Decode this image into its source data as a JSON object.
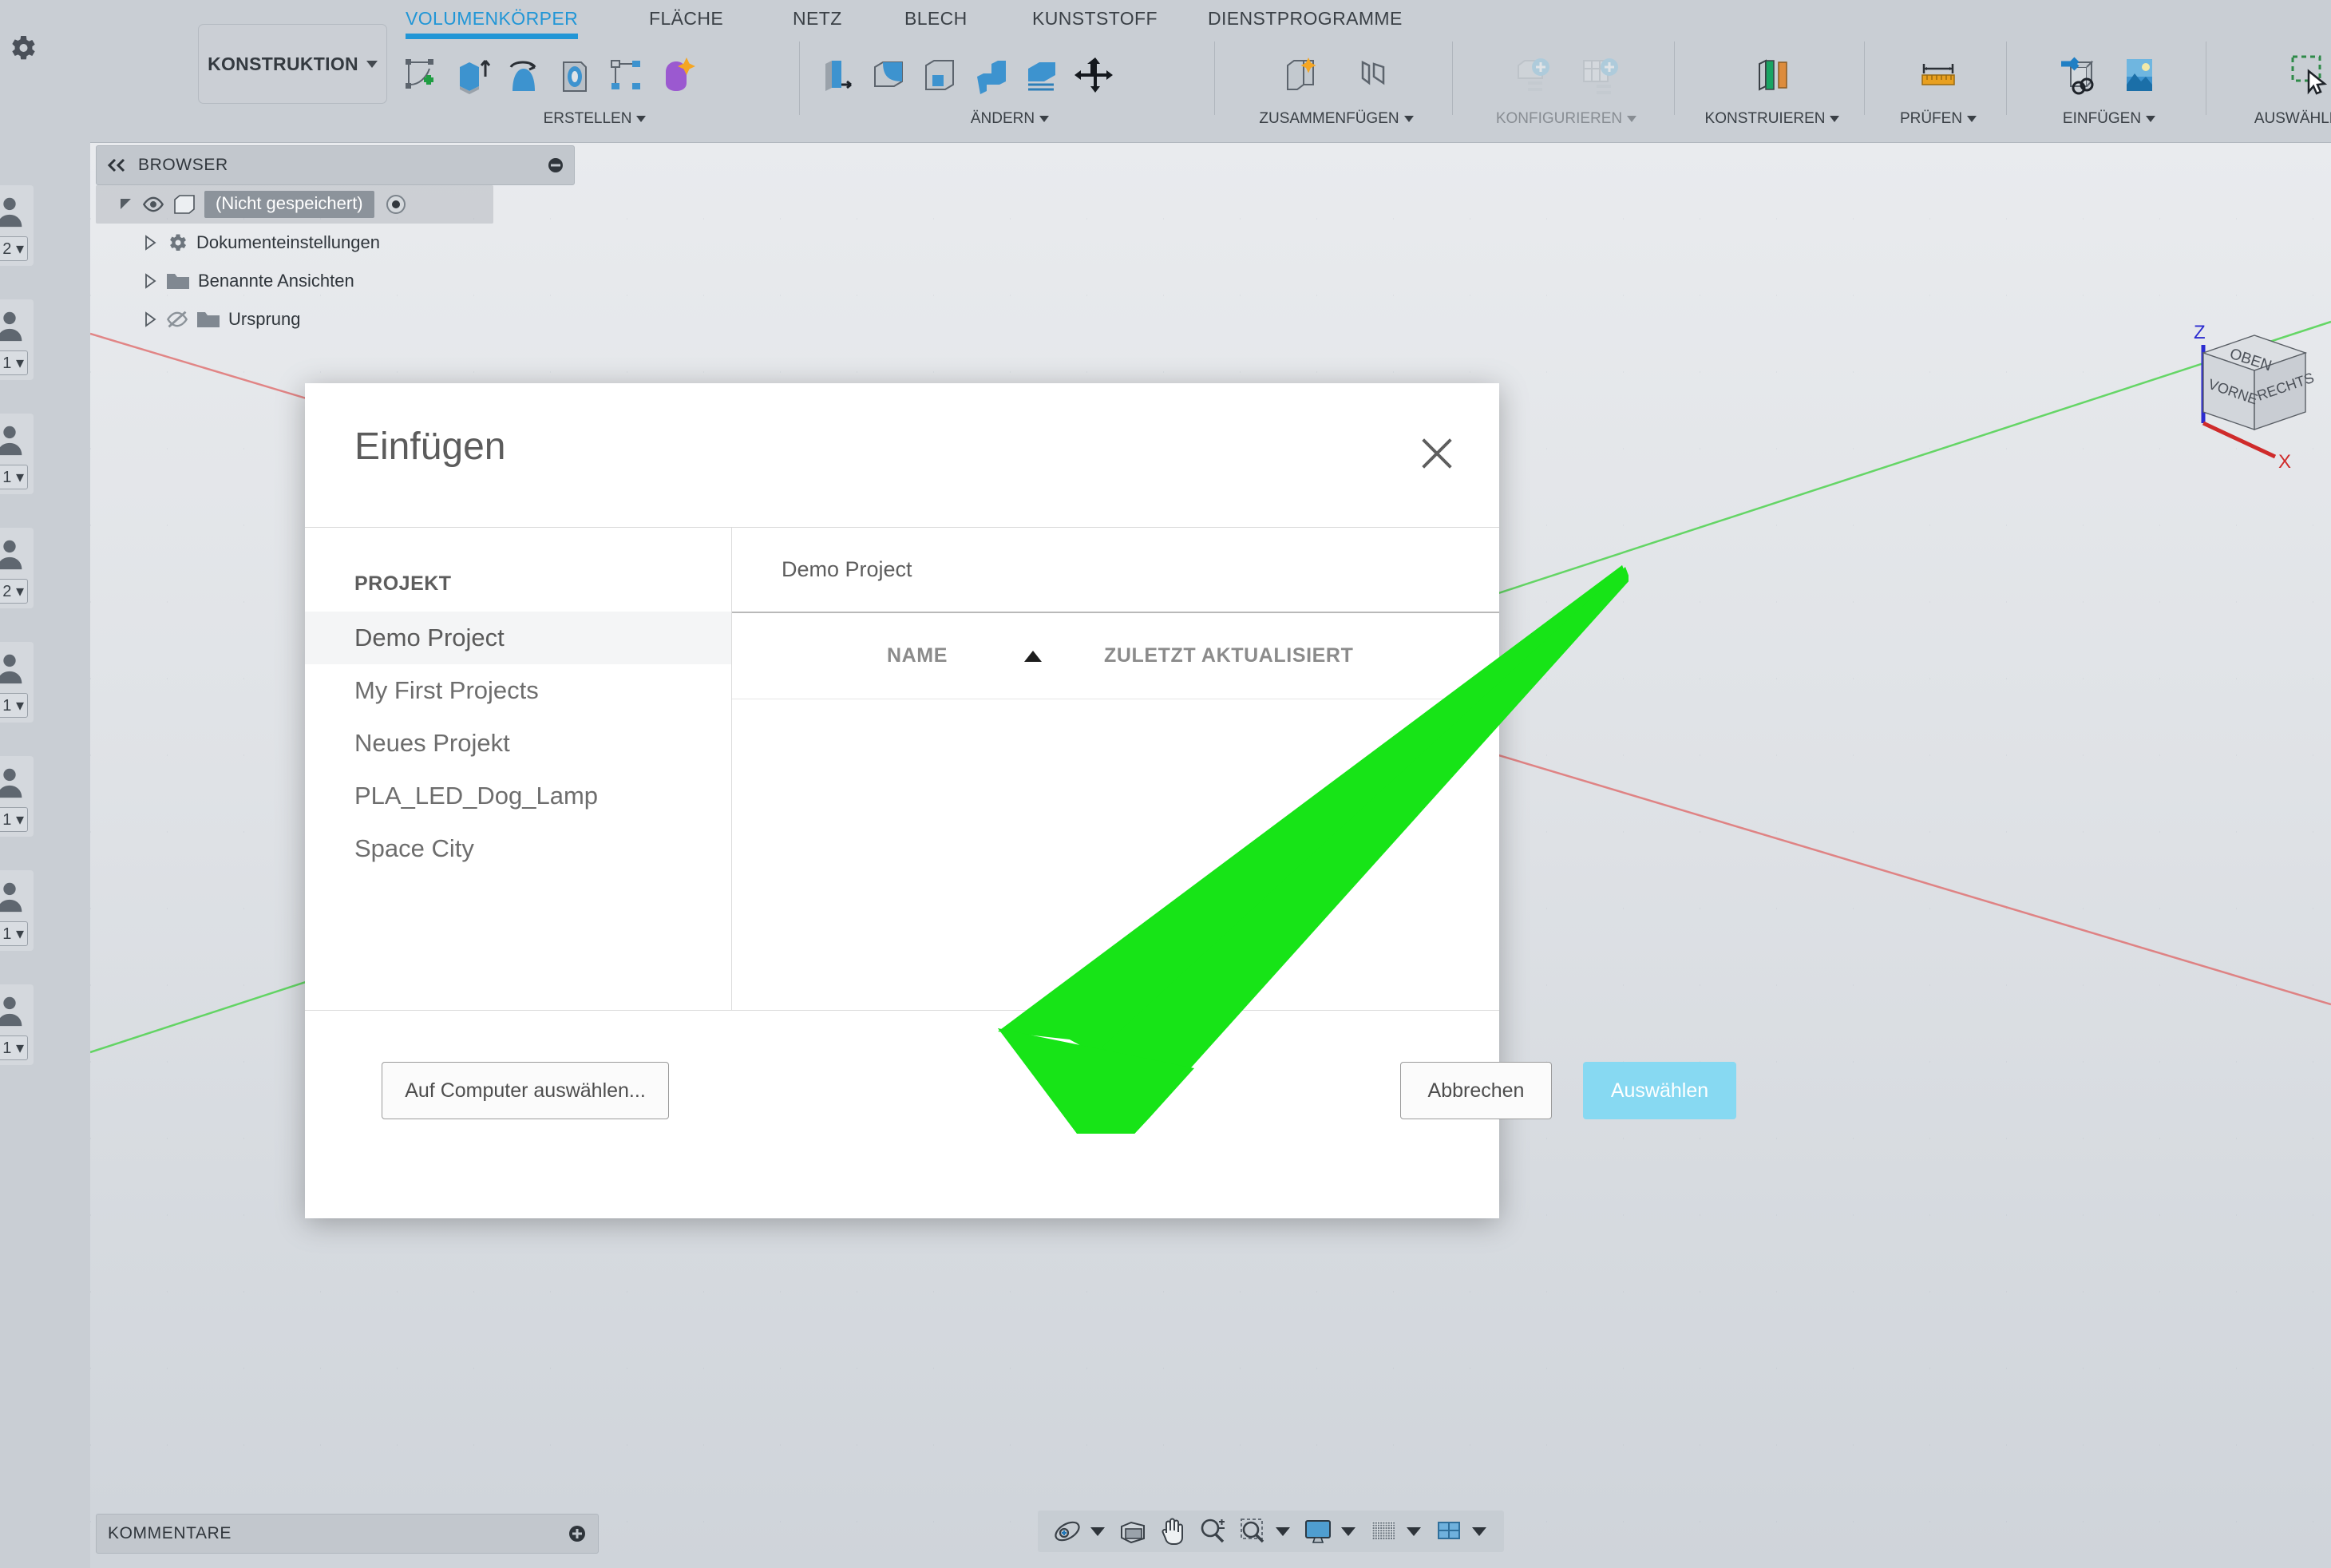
{
  "app": {
    "workspace_button": "KONSTRUKTION",
    "settings_icon": "gear-icon"
  },
  "ribbon": {
    "tabs": [
      {
        "label": "VOLUMENKÖRPER",
        "active": true
      },
      {
        "label": "FLÄCHE",
        "active": false
      },
      {
        "label": "NETZ",
        "active": false
      },
      {
        "label": "BLECH",
        "active": false
      },
      {
        "label": "KUNSTSTOFF",
        "active": false
      },
      {
        "label": "DIENSTPROGRAMME",
        "active": false
      }
    ],
    "panels": [
      {
        "label": "ERSTELLEN",
        "icons": [
          "sketch-create-icon",
          "extrude-icon",
          "revolve-icon",
          "sweep-icon",
          "pattern-icon",
          "form-icon"
        ]
      },
      {
        "label": "ÄNDERN",
        "icons": [
          "press-pull-icon",
          "fillet-icon",
          "shell-icon",
          "combine-icon",
          "offset-face-icon",
          "move-copy-icon"
        ]
      },
      {
        "label": "ZUSAMMENFÜGEN",
        "icons": [
          "new-component-icon",
          "joint-icon"
        ]
      },
      {
        "label": "KONFIGURIEREN",
        "icons": [
          "configure-icon",
          "configure-table-icon"
        ]
      },
      {
        "label": "KONSTRUIEREN",
        "icons": [
          "plane-icon"
        ]
      },
      {
        "label": "PRÜFEN",
        "icons": [
          "measure-icon"
        ]
      },
      {
        "label": "EINFÜGEN",
        "icons": [
          "insert-derive-icon",
          "insert-image-icon"
        ]
      },
      {
        "label": "AUSWÄHLEN",
        "icons": [
          "selection-window-icon"
        ]
      }
    ]
  },
  "browser": {
    "title": "BROWSER",
    "collapse_icon": "double-chevron-left-icon",
    "minimize_icon": "minus-circle-icon",
    "tree": [
      {
        "label": "(Nicht gespeichert)",
        "icon": "body-icon",
        "selected": true,
        "has_eye": true,
        "has_radio": true,
        "expander": "expanded"
      },
      {
        "label": "Dokumenteinstellungen",
        "icon": "gear-icon",
        "selected": false,
        "expander": "collapsed"
      },
      {
        "label": "Benannte Ansichten",
        "icon": "folder-icon",
        "selected": false,
        "expander": "collapsed"
      },
      {
        "label": "Ursprung",
        "icon": "folder-icon",
        "selected": false,
        "expander": "collapsed",
        "has_eye_off": true
      }
    ]
  },
  "comments": {
    "title": "KOMMENTARE",
    "add_icon": "plus-circle-icon"
  },
  "navbar": {
    "items": [
      {
        "name": "orbit-icon",
        "caret": true
      },
      {
        "name": "look-at-icon",
        "caret": false
      },
      {
        "name": "pan-hand-icon",
        "caret": false
      },
      {
        "name": "zoom-icon",
        "caret": false
      },
      {
        "name": "zoom-window-icon",
        "caret": true
      },
      {
        "name": "display-settings-icon",
        "caret": true
      },
      {
        "name": "grid-snap-icon",
        "caret": true
      },
      {
        "name": "viewports-icon",
        "caret": true
      }
    ]
  },
  "viewcube": {
    "top_face": "OBEN",
    "front_face": "VORNE",
    "right_face": "RECHTS",
    "axis_z": "Z",
    "axis_x": "X"
  },
  "sidebar_avatars": [
    {
      "icon": "person-icon",
      "count": "2"
    },
    {
      "icon": "person-icon",
      "count": "1"
    },
    {
      "icon": "person-icon",
      "count": "1"
    },
    {
      "icon": "person-icon",
      "count": "2"
    },
    {
      "icon": "person-icon",
      "count": "1"
    },
    {
      "icon": "person-icon",
      "count": "1"
    },
    {
      "icon": "person-icon",
      "count": "1"
    },
    {
      "icon": "person-icon",
      "count": "1"
    }
  ],
  "dialog": {
    "title": "Einfügen",
    "close_icon": "close-icon",
    "project_header": "PROJEKT",
    "projects": [
      {
        "label": "Demo Project",
        "selected": true
      },
      {
        "label": "My First Projects",
        "selected": false
      },
      {
        "label": "Neues Projekt",
        "selected": false
      },
      {
        "label": "PLA_LED_Dog_Lamp",
        "selected": false
      },
      {
        "label": "Space City",
        "selected": false
      }
    ],
    "breadcrumb": "Demo Project",
    "columns": [
      {
        "label": "NAME",
        "sorted": true,
        "sort_dir": "asc"
      },
      {
        "label": "ZULETZT AKTUALISIERT",
        "sorted": false
      }
    ],
    "rows": [],
    "buttons": {
      "local": "Auf Computer auswählen...",
      "cancel": "Abbrechen",
      "confirm": "Auswählen"
    }
  },
  "annotation": {
    "arrow_color": "#17e417",
    "points_to": "Auf Computer auswählen..."
  }
}
